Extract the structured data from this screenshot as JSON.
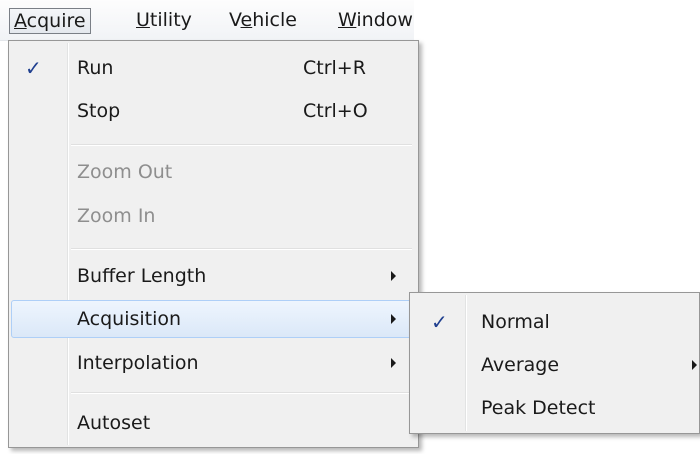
{
  "menubar": {
    "items": [
      {
        "pre": "",
        "mnemonic": "A",
        "post": "cquire"
      },
      {
        "pre": "",
        "mnemonic": "U",
        "post": "tility"
      },
      {
        "pre": "V",
        "mnemonic": "e",
        "post": "hicle"
      },
      {
        "pre": "",
        "mnemonic": "W",
        "post": "indow"
      }
    ]
  },
  "acquire_menu": {
    "run": {
      "label": "Run",
      "shortcut": "Ctrl+R",
      "checked": true
    },
    "stop": {
      "label": "Stop",
      "shortcut": "Ctrl+O"
    },
    "zoom_out": {
      "label": "Zoom Out",
      "enabled": false
    },
    "zoom_in": {
      "label": "Zoom In",
      "enabled": false
    },
    "buffer_length": {
      "label": "Buffer Length"
    },
    "acquisition": {
      "label": "Acquisition"
    },
    "interpolation": {
      "label": "Interpolation"
    },
    "autoset": {
      "label": "Autoset"
    }
  },
  "acquisition_submenu": {
    "normal": {
      "label": "Normal",
      "checked": true
    },
    "average": {
      "label": "Average"
    },
    "peak_detect": {
      "label": "Peak Detect"
    }
  },
  "check_glyph": "✓",
  "colors": {
    "menu_bg": "#f0f0f0",
    "highlight_border": "#aecff7",
    "check": "#1f3f8f",
    "disabled_text": "#8e8e8e"
  }
}
